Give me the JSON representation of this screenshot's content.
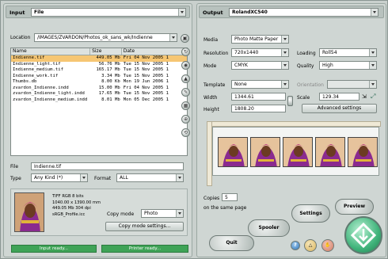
{
  "input": {
    "label": "Input",
    "source": "File",
    "location_label": "Location",
    "location_path": "/IMAGES/ZVARDON/Photos_ok_sans_wk/Indienne",
    "columns": [
      "Name",
      "Size",
      "Date"
    ],
    "files": [
      {
        "name": "Indienne.tif",
        "size": "449.05 Mb",
        "date": "Fri 04 Nov 2005 1",
        "selected": true
      },
      {
        "name": "Indienne_light.tif",
        "size": "56.76 Mb",
        "date": "Tue 15 Nov 2005 1"
      },
      {
        "name": "Indienne_medium.tif",
        "size": "165.17 Mb",
        "date": "Tue 15 Nov 2005 1"
      },
      {
        "name": "Indienne_work.tif",
        "size": "3.34 Mb",
        "date": "Tue 15 Nov 2005 1"
      },
      {
        "name": "Thumbs.db",
        "size": "8.00 Kb",
        "date": "Mon 19 Jun 2006 1"
      },
      {
        "name": "zvardon_Indienne.indd",
        "size": "15.00 Mb",
        "date": "Fri 04 Nov 2005 1"
      },
      {
        "name": "zvardon_Indienne_light.indd",
        "size": "17.65 Mb",
        "date": "Tue 15 Nov 2005 1"
      },
      {
        "name": "zvardon_Indienne_medium.indd",
        "size": "8.01 Mb",
        "date": "Mon 05 Dec 2005 1"
      }
    ],
    "file_label": "File",
    "file_value": "Indienne.tif",
    "type_label": "Type",
    "type_value": "Any Kind (*)",
    "format_label": "Format",
    "format_value": "ALL",
    "info": [
      "TIFF  RGB 8 bits",
      "1040.00 x 1390.00 mm",
      "449.05 Mb 304 dpi",
      "sRGB_Profile.icc"
    ],
    "copy_mode_label": "Copy mode",
    "copy_mode_value": "Photo",
    "copy_mode_settings": "Copy mode settings...",
    "status_input": "Input ready...",
    "status_printer": "Printer ready..."
  },
  "output": {
    "label": "Output",
    "printer": "RolandXC540",
    "media_label": "Media",
    "media_value": "Photo Matte Paper",
    "resolution_label": "Resolution",
    "resolution_value": "720x1440",
    "loading_label": "Loading",
    "loading_value": "Roll54",
    "mode_label": "Mode",
    "mode_value": "CMYK",
    "quality_label": "Quality",
    "quality_value": "High",
    "template_label": "Template",
    "template_value": "None",
    "orientation_label": "Orientation",
    "width_label": "Width",
    "width_value": "1344.61",
    "scale_label": "Scale",
    "scale_value": "129.34",
    "height_label": "Height",
    "height_value": "1808.20",
    "advanced_settings": "Advanced settings",
    "copies_label": "Copies",
    "copies_value": "5",
    "same_page": "on the same page",
    "settings_btn": "Settings",
    "preview_btn": "Preview",
    "spooler_btn": "Spooler",
    "quit_btn": "Quit",
    "thumb_count": 5
  },
  "colors": {
    "selected_row": "#f6c673",
    "status_green": "#3fa357",
    "print_button": "#3fb37a"
  },
  "icons": [
    "folder-icon",
    "refresh-icon",
    "eye-icon",
    "up-icon",
    "pencil-icon",
    "grid-icon",
    "zoom-icon",
    "rotate-icon",
    "help-icon",
    "warning-icon",
    "stop-icon",
    "print-icon"
  ]
}
